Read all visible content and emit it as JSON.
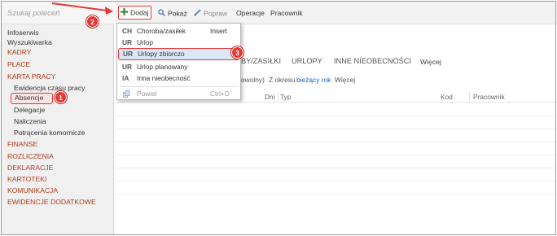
{
  "sidebar": {
    "search_placeholder": "Szukaj poleceń",
    "items": [
      {
        "label": "Infoserwis",
        "style": "plain"
      },
      {
        "label": "Wyszukiwarka",
        "style": "plain"
      },
      {
        "label": "KADRY",
        "style": "red"
      },
      {
        "label": "PŁACE",
        "style": "red"
      },
      {
        "label": "KARTA PRACY",
        "style": "red"
      },
      {
        "label": "Ewidencja czasu pracy",
        "style": "sub"
      },
      {
        "label": "Absencje",
        "style": "selected"
      },
      {
        "label": "Delegacje",
        "style": "sub"
      },
      {
        "label": "Naliczenia",
        "style": "sub"
      },
      {
        "label": "Potrącenia komornicze",
        "style": "sub"
      },
      {
        "label": "FINANSE",
        "style": "red"
      },
      {
        "label": "ROZLICZENIA",
        "style": "red"
      },
      {
        "label": "DEKLARACJE",
        "style": "red"
      },
      {
        "label": "KARTOTEKI",
        "style": "red"
      },
      {
        "label": "KOMUNIKACJA",
        "style": "red"
      },
      {
        "label": "EWIDENCJE DODATKOWE",
        "style": "red"
      }
    ]
  },
  "toolbar": {
    "add_label": "Dodaj",
    "show_label": "Pokaż",
    "edit_label": "Popraw",
    "operations_label": "Operacje",
    "employee_label": "Pracownik"
  },
  "menu": {
    "items": [
      {
        "code": "CH",
        "label": "Choroba/zasiłek",
        "shortcut": "Insert"
      },
      {
        "code": "UR",
        "label": "Urlop",
        "shortcut": ""
      },
      {
        "code": "UR",
        "label": "Urlopy zbiorczo",
        "shortcut": ""
      },
      {
        "code": "UR",
        "label": "Urlop planowany",
        "shortcut": ""
      },
      {
        "code": "IA",
        "label": "Inna nieobecność",
        "shortcut": ""
      }
    ],
    "repeat_label": "Powiel",
    "repeat_shortcut": "Ctrl+D"
  },
  "tabs": {
    "tab1": "BY/ZASIŁKI",
    "tab2": "URLOPY",
    "tab3": "INNE NIEOBECNOŚCI",
    "more": "Więcej"
  },
  "filters": {
    "prefix": "owolny)",
    "period_label": "Z okresu",
    "period_value": "bieżący rok",
    "more": "Więcej"
  },
  "grid": {
    "columns": [
      "Dni",
      "Typ",
      "Kod",
      "Pracownik"
    ]
  },
  "callouts": {
    "one": "1",
    "two": "2",
    "three": "3"
  },
  "colors": {
    "accent_red": "#e53935",
    "nav_red": "#b03a1a",
    "link_blue": "#1565c0",
    "menu_highlight": "#dbe7f7",
    "add_green": "#2e7d32"
  }
}
